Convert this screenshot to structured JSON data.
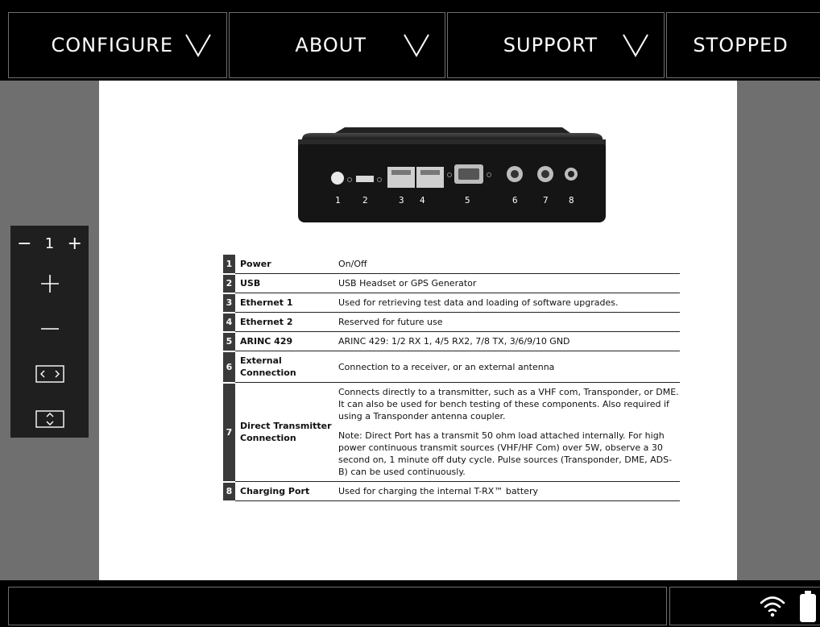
{
  "nav": {
    "configure_label": "CONFIGURE",
    "about_label": "ABOUT",
    "support_label": "SUPPORT",
    "status_label": "STOPPED"
  },
  "zoom": {
    "minus_symbol": "−",
    "page_number": "1",
    "plus_symbol": "+"
  },
  "device": {
    "port_numbers": [
      "1",
      "2",
      "3",
      "4",
      "5",
      "6",
      "7",
      "8"
    ]
  },
  "spec_table": {
    "rows": [
      {
        "num": "1",
        "name": "Power",
        "desc": "On/Off"
      },
      {
        "num": "2",
        "name": "USB",
        "desc": "USB Headset or GPS Generator"
      },
      {
        "num": "3",
        "name": "Ethernet 1",
        "desc": "Used for retrieving test data and loading of software upgrades."
      },
      {
        "num": "4",
        "name": "Ethernet 2",
        "desc": "Reserved for future use"
      },
      {
        "num": "5",
        "name": "ARINC 429",
        "desc": "ARINC 429: 1/2 RX 1, 4/5 RX2, 7/8 TX, 3/6/9/10 GND"
      },
      {
        "num": "6",
        "name": "External Connection",
        "desc": "Connection to a receiver, or an external antenna"
      },
      {
        "num": "7",
        "name": "Direct Transmitter Connection",
        "desc": "Connects directly to a transmitter, such as a VHF com, Transponder, or DME. It can also be used for bench testing of these components. Also required if using a Transponder antenna coupler.",
        "desc_note": "Note: Direct Port has a transmit 50 ohm load attached internally. For high power continuous transmit sources (VHF/HF Com) over 5W, observe a 30 second on, 1 minute off duty cycle. Pulse sources (Transponder, DME, ADS-B) can be used continuously."
      },
      {
        "num": "8",
        "name": "Charging Port",
        "desc": "Used for charging the internal T-RX™ battery"
      }
    ]
  },
  "status_icons": [
    "wifi-icon",
    "battery-icon"
  ]
}
